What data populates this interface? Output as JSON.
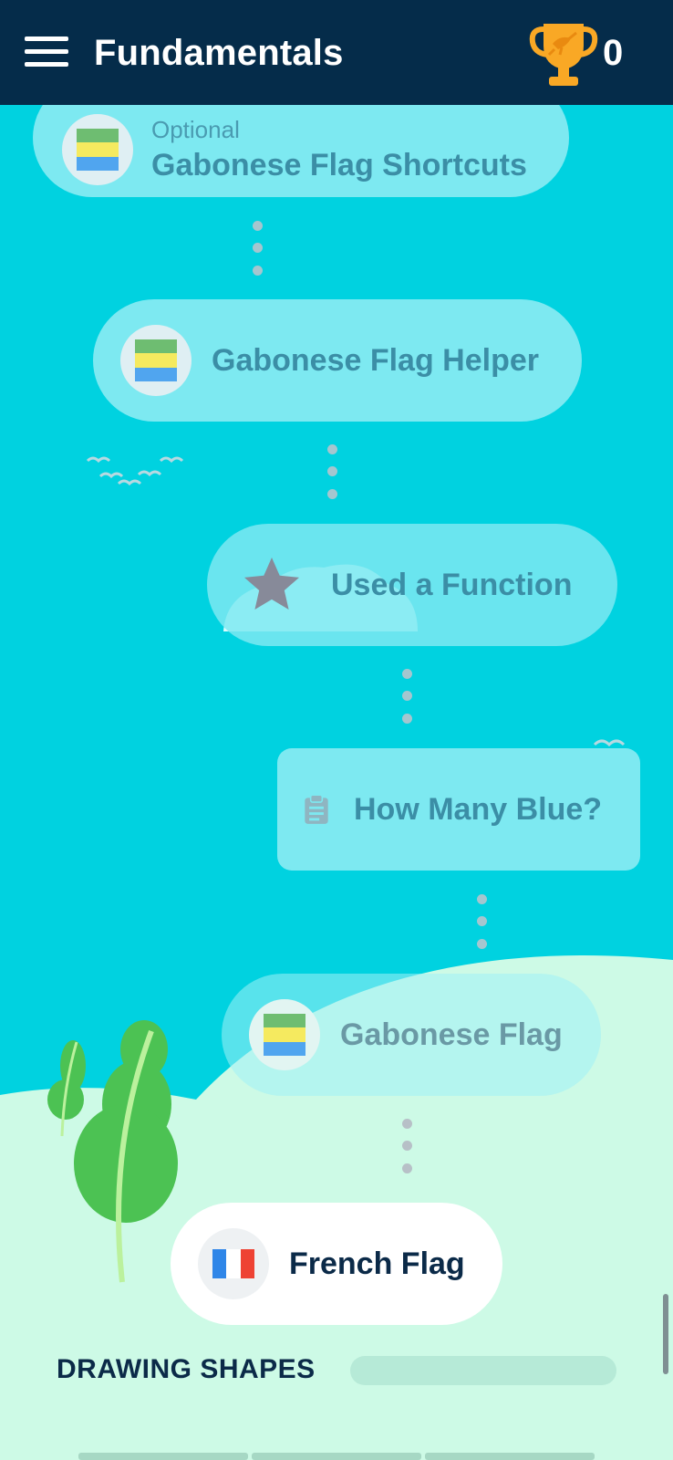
{
  "header": {
    "title": "Fundamentals",
    "trophy_count": "0"
  },
  "levels": [
    {
      "sub_label": "Optional",
      "label": "Gabonese Flag Shortcuts",
      "icon": "gabon-flag-icon"
    },
    {
      "label": "Gabonese Flag Helper",
      "icon": "gabon-flag-icon"
    },
    {
      "label": "Used a Function",
      "icon": "star-icon"
    },
    {
      "label": "How Many Blue?",
      "icon": "clipboard-icon"
    },
    {
      "label": "Gabonese Flag",
      "icon": "gabon-flag-icon"
    },
    {
      "label": "French Flag",
      "icon": "france-flag-icon"
    }
  ],
  "section": {
    "title": "DRAWING SHAPES",
    "progress": 0
  },
  "colors": {
    "header_bg": "#052c4a",
    "sky": "#00d2e0",
    "pill": "#7de9f1",
    "pill_text": "#3b8ea6",
    "hill": "#cdfae6",
    "tree": "#4cc253",
    "trophy": "#f9a825",
    "flag_gabon": [
      "#6ebd71",
      "#f5ea5f",
      "#50a5ef"
    ],
    "flag_france": [
      "#2f86e8",
      "#ffffff",
      "#ee4233"
    ]
  }
}
